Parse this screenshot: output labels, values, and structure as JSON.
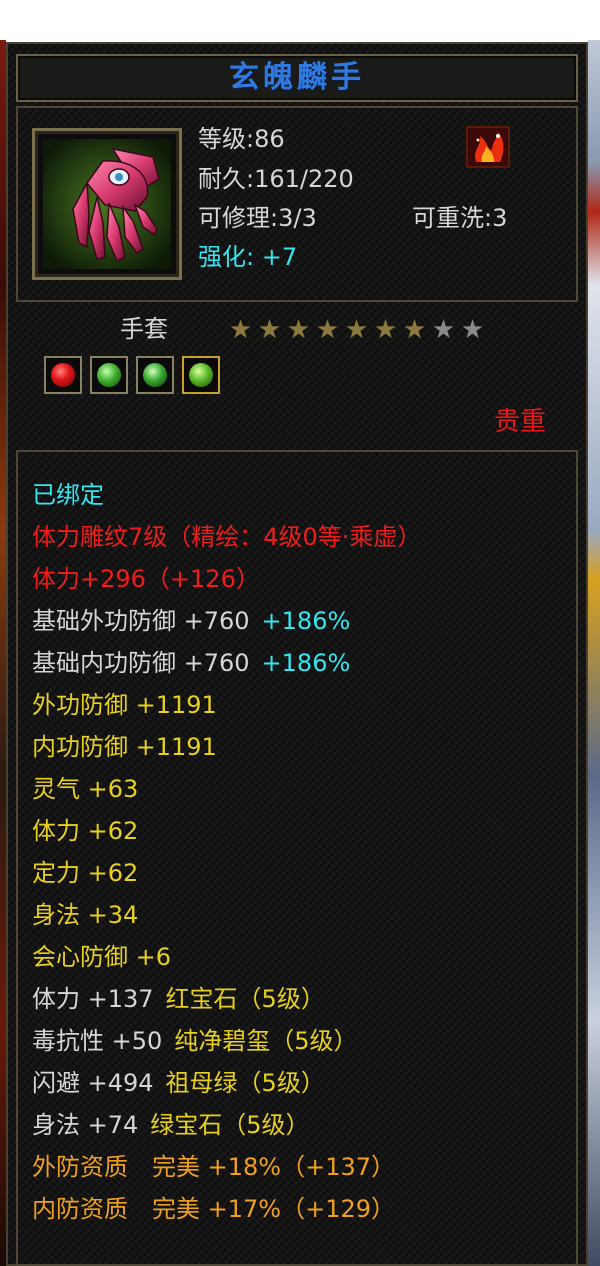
{
  "item": {
    "name": "玄魄麟手",
    "level": "等级:86",
    "durability": "耐久:161/220",
    "repairable": "可修理:3/3",
    "rewashable": "可重洗:3",
    "enhance": "强化: +7",
    "type": "手套",
    "stars": {
      "filled": 7,
      "total": 9
    },
    "gems": [
      "red-ruby-gem",
      "jade-gem",
      "emerald-gem",
      "green-gem"
    ],
    "rarity": "贵重"
  },
  "colors": {
    "title": "#2f7ae0",
    "cyan": "#33e6f0",
    "red": "#f01c1c",
    "yellow": "#e8d020",
    "orange": "#f0a020",
    "white": "#d6d6d6"
  },
  "attributes": {
    "bound": "已绑定",
    "engrave": "体力雕纹7级（精绘：4级0等·乘虚）",
    "stamina_total": "体力+296（+126）",
    "base_ext_def": "基础外功防御 +760",
    "base_ext_def_pct": "+186%",
    "base_int_def": "基础内功防御 +760",
    "base_int_def_pct": "+186%",
    "ext_def": "外功防御 +1191",
    "int_def": "内功防御 +1191",
    "spirit": "灵气 +63",
    "stamina": "体力 +62",
    "focus": "定力 +62",
    "agility": "身法 +34",
    "crit_def": "会心防御 +6",
    "gem1_stat": "体力 +137",
    "gem1_name": "红宝石（5级）",
    "gem2_stat": "毒抗性 +50",
    "gem2_name": "纯净碧玺（5级）",
    "gem3_stat": "闪避 +494",
    "gem3_name": "祖母绿（5级）",
    "gem4_stat": "身法 +74",
    "gem4_name": "绿宝石（5级）",
    "ext_quality": "外防资质　完美 +18%（+137）",
    "int_quality": "内防资质　完美 +17%（+129）"
  }
}
